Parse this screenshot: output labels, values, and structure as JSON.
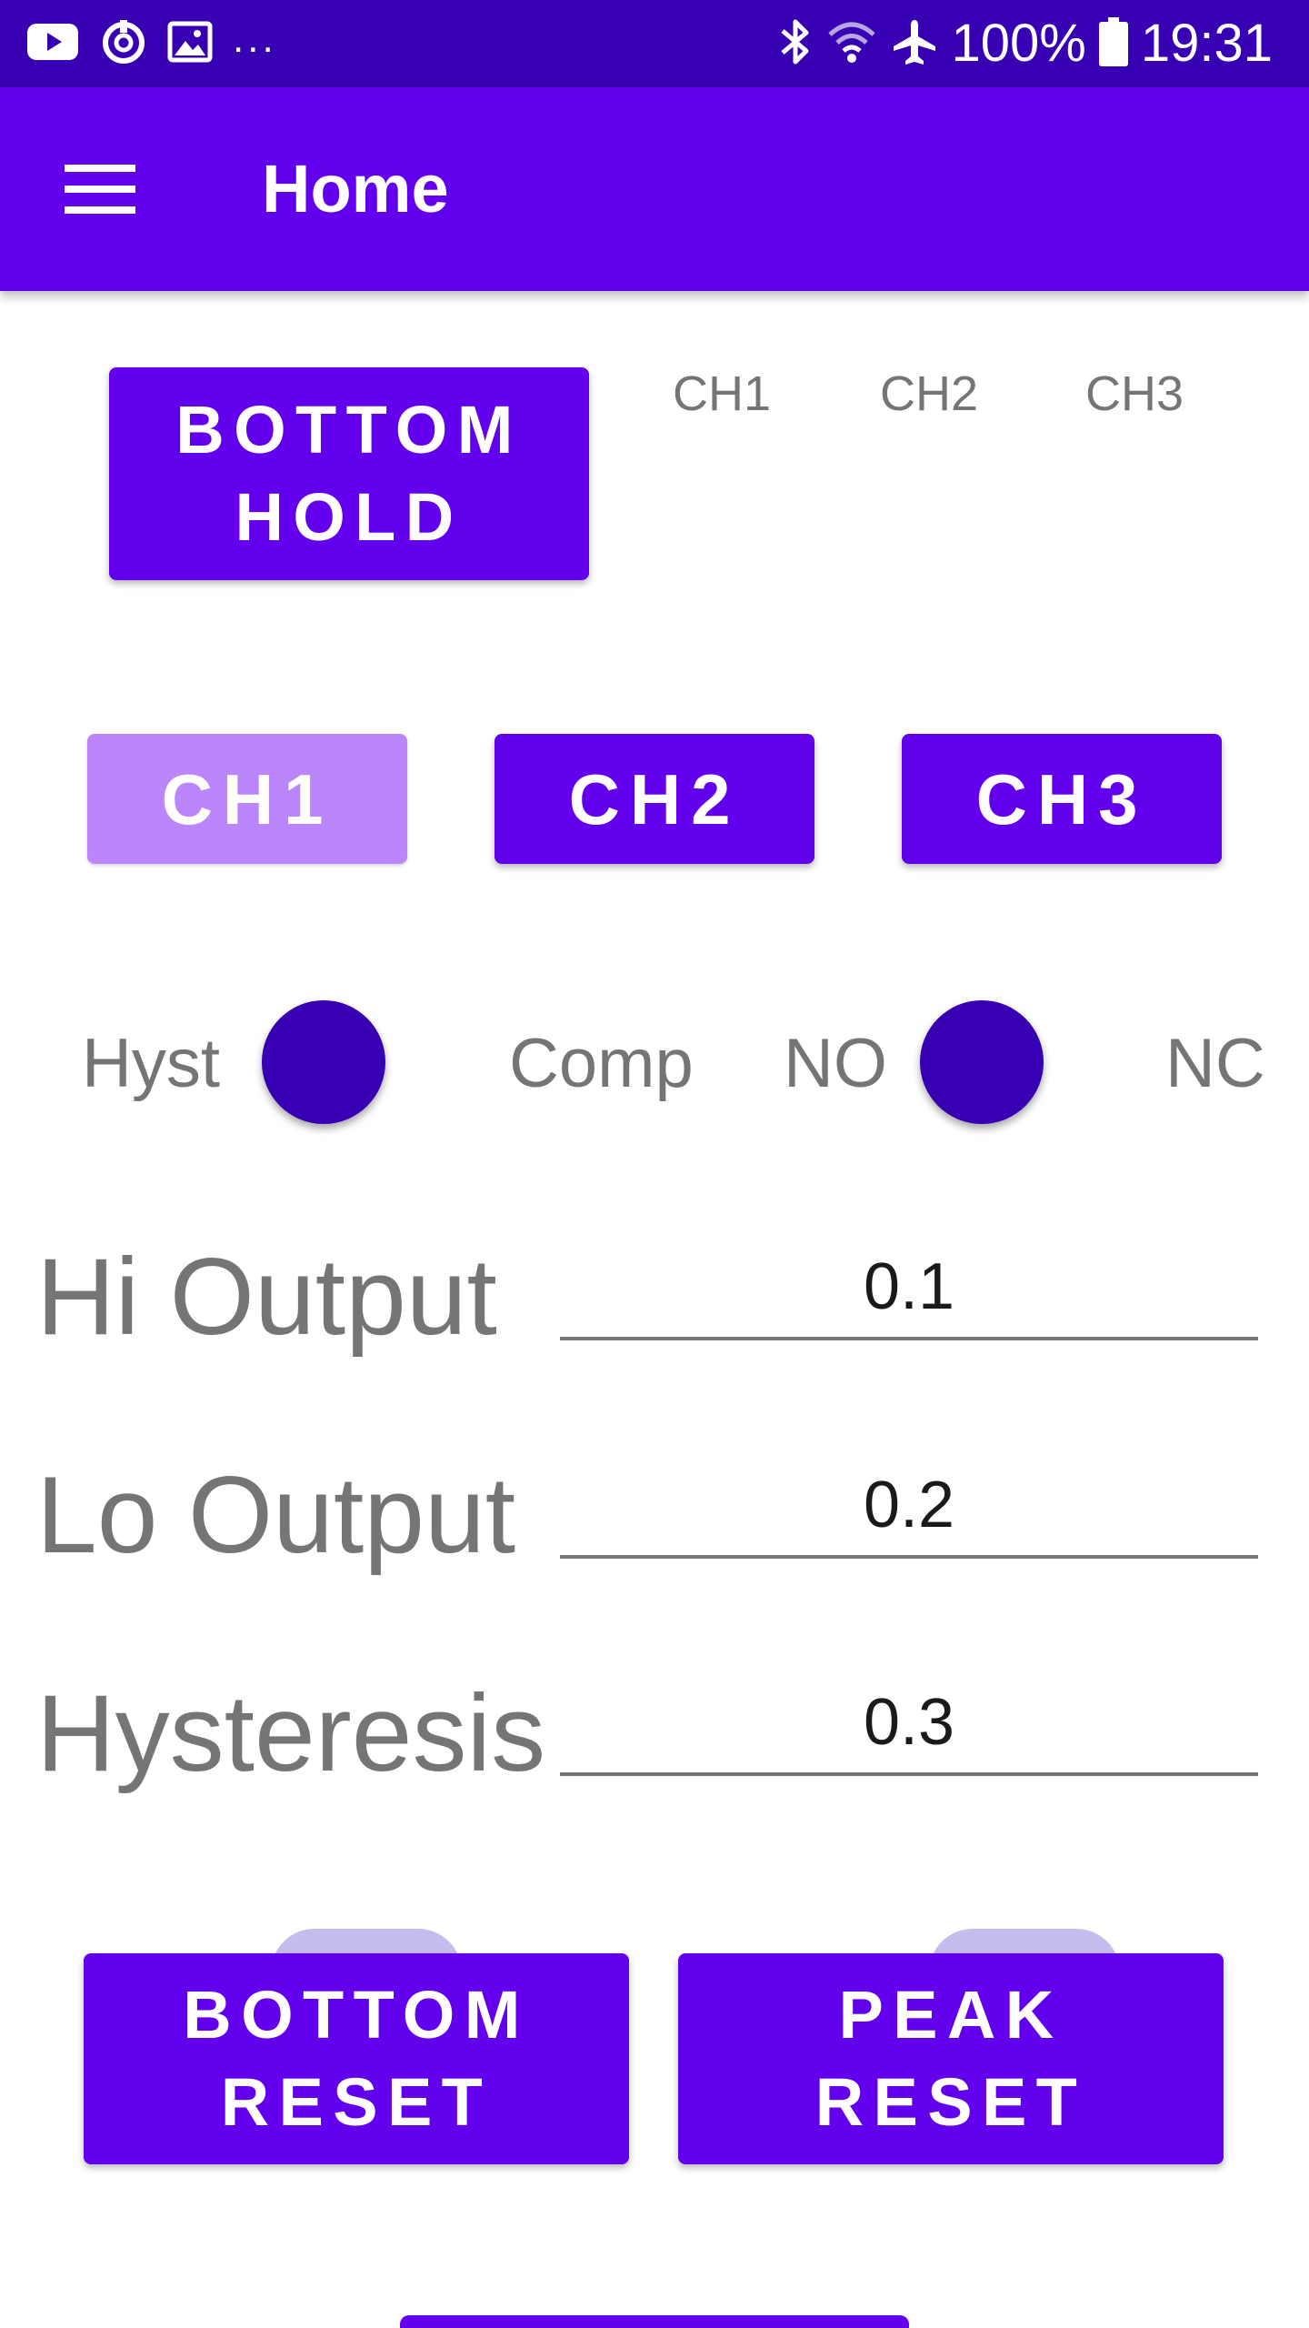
{
  "status_bar": {
    "more": "...",
    "battery": "100%",
    "time": "19:31",
    "icons": [
      "youtube-icon",
      "power-icon",
      "image-icon",
      "bluetooth-icon",
      "wifi-icon",
      "airplane-icon",
      "battery-icon"
    ]
  },
  "app_bar": {
    "title": "Home",
    "menu_icon": "menu-icon"
  },
  "controls": {
    "bottom_hold_line1": "BOTTOM",
    "bottom_hold_line2": "HOLD",
    "channel_labels": [
      "CH1",
      "CH2",
      "CH3"
    ],
    "channel_buttons": [
      {
        "label": "CH1",
        "enabled": false
      },
      {
        "label": "CH2",
        "enabled": true
      },
      {
        "label": "CH3",
        "enabled": true
      }
    ]
  },
  "switches": {
    "mode": {
      "left_label": "Hyst",
      "right_label": "Comp",
      "checked": false
    },
    "contact": {
      "left_label": "NO",
      "right_label": "NC",
      "checked": false
    }
  },
  "fields": [
    {
      "label": "Hi Output",
      "value": "0.1"
    },
    {
      "label": "Lo Output",
      "value": "0.2"
    },
    {
      "label": "Hysteresis",
      "value": "0.3"
    }
  ],
  "actions": {
    "bottom_reset_line1": "BOTTOM",
    "bottom_reset_line2": "RESET",
    "peak_reset_line1": "PEAK",
    "peak_reset_line2": "RESET"
  },
  "colors": {
    "primary": "#6200ee",
    "primary_dark": "#3700b3",
    "disabled_button": "#bb86fc",
    "switch_track": "#c7bdec",
    "label_gray": "#757575"
  }
}
